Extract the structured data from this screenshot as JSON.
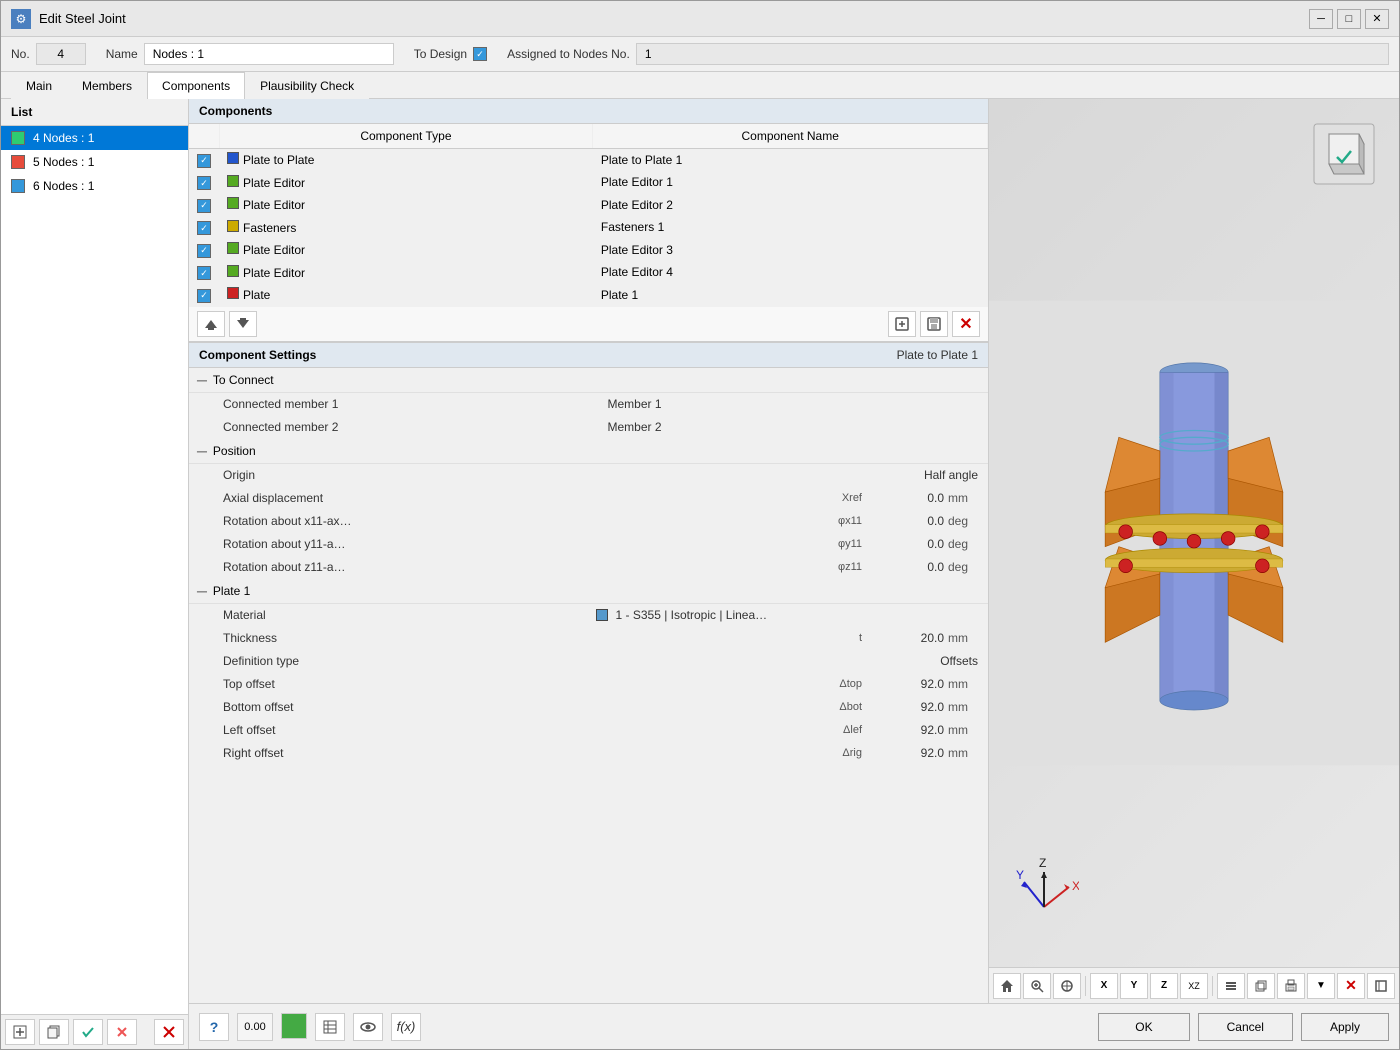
{
  "window": {
    "title": "Edit Steel Joint",
    "icon": "🔩"
  },
  "header": {
    "no_label": "No.",
    "no_value": "4",
    "name_label": "Name",
    "name_value": "Nodes : 1",
    "to_design_label": "To Design",
    "assigned_label": "Assigned to Nodes No.",
    "assigned_value": "1"
  },
  "tabs": {
    "items": [
      "Main",
      "Members",
      "Components",
      "Plausibility Check"
    ],
    "active": "Components"
  },
  "list": {
    "header": "List",
    "items": [
      {
        "label": "4  Nodes : 1",
        "color": "green",
        "selected": true
      },
      {
        "label": "5  Nodes : 1",
        "color": "red",
        "selected": false
      },
      {
        "label": "6  Nodes : 1",
        "color": "blue",
        "selected": false
      }
    ]
  },
  "components": {
    "section_label": "Components",
    "col_type": "Component Type",
    "col_name": "Component Name",
    "rows": [
      {
        "checked": true,
        "color": "blue",
        "type": "Plate to Plate",
        "name": "Plate to Plate 1"
      },
      {
        "checked": true,
        "color": "green",
        "type": "Plate Editor",
        "name": "Plate Editor 1"
      },
      {
        "checked": true,
        "color": "green",
        "type": "Plate Editor",
        "name": "Plate Editor 2"
      },
      {
        "checked": true,
        "color": "yellow",
        "type": "Fasteners",
        "name": "Fasteners 1"
      },
      {
        "checked": true,
        "color": "green",
        "type": "Plate Editor",
        "name": "Plate Editor 3"
      },
      {
        "checked": true,
        "color": "green",
        "type": "Plate Editor",
        "name": "Plate Editor 4"
      },
      {
        "checked": true,
        "color": "red",
        "type": "Plate",
        "name": "Plate 1"
      }
    ]
  },
  "component_settings": {
    "label": "Component Settings",
    "component_name": "Plate to Plate 1",
    "sections": {
      "to_connect": {
        "label": "To Connect",
        "rows": [
          {
            "label": "Connected member 1",
            "value": "Member 1"
          },
          {
            "label": "Connected member 2",
            "value": "Member 2"
          }
        ]
      },
      "position": {
        "label": "Position",
        "rows": [
          {
            "label": "Origin",
            "sym": "",
            "value": "Half angle",
            "unit": ""
          },
          {
            "label": "Axial displacement",
            "sym": "Xref",
            "value": "0.0",
            "unit": "mm"
          },
          {
            "label": "Rotation about x11-ax…",
            "sym": "φx11",
            "value": "0.0",
            "unit": "deg"
          },
          {
            "label": "Rotation about y11-a…",
            "sym": "φy11",
            "value": "0.0",
            "unit": "deg"
          },
          {
            "label": "Rotation about z11-a…",
            "sym": "φz11",
            "value": "0.0",
            "unit": "deg"
          }
        ]
      },
      "plate1": {
        "label": "Plate 1",
        "rows": [
          {
            "label": "Material",
            "sym": "",
            "value": "1 - S355 | Isotropic | Linea…",
            "unit": ""
          },
          {
            "label": "Thickness",
            "sym": "t",
            "value": "20.0",
            "unit": "mm"
          },
          {
            "label": "Definition type",
            "sym": "",
            "value": "Offsets",
            "unit": ""
          },
          {
            "label": "Top offset",
            "sym": "Δtop",
            "value": "92.0",
            "unit": "mm"
          },
          {
            "label": "Bottom offset",
            "sym": "Δbot",
            "value": "92.0",
            "unit": "mm"
          },
          {
            "label": "Left offset",
            "sym": "Δlef",
            "value": "92.0",
            "unit": "mm"
          },
          {
            "label": "Right offset",
            "sym": "Δrig",
            "value": "92.0",
            "unit": "mm"
          }
        ]
      }
    }
  },
  "bottom_toolbar": {
    "ok": "OK",
    "cancel": "Cancel",
    "apply": "Apply"
  }
}
